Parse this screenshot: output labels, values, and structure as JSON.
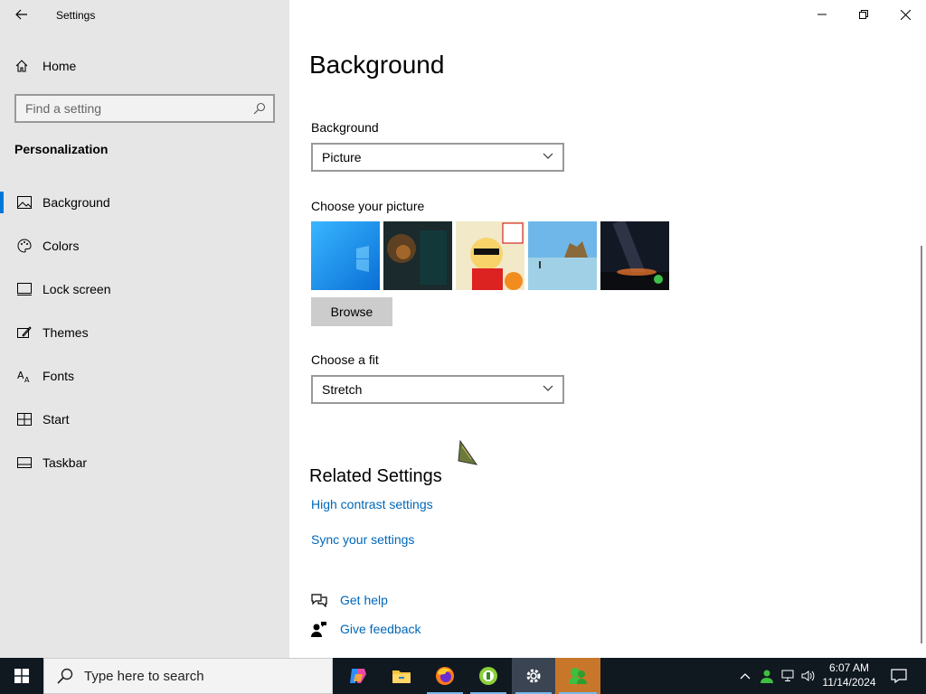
{
  "window": {
    "title": "Settings"
  },
  "sidebar": {
    "home_label": "Home",
    "search_placeholder": "Find a setting",
    "section_title": "Personalization",
    "items": [
      {
        "label": "Background",
        "icon": "picture-icon",
        "active": true
      },
      {
        "label": "Colors",
        "icon": "palette-icon"
      },
      {
        "label": "Lock screen",
        "icon": "lock-screen-icon"
      },
      {
        "label": "Themes",
        "icon": "themes-icon"
      },
      {
        "label": "Fonts",
        "icon": "fonts-icon"
      },
      {
        "label": "Start",
        "icon": "start-icon"
      },
      {
        "label": "Taskbar",
        "icon": "taskbar-icon"
      }
    ]
  },
  "main": {
    "title": "Background",
    "background_label": "Background",
    "background_value": "Picture",
    "choose_picture_label": "Choose your picture",
    "browse_label": "Browse",
    "fit_label": "Choose a fit",
    "fit_value": "Stretch",
    "related_title": "Related Settings",
    "related_links": [
      "High contrast settings",
      "Sync your settings"
    ],
    "help": {
      "get_help": "Get help",
      "give_feedback": "Give feedback"
    }
  },
  "taskbar": {
    "search_placeholder": "Type here to search",
    "time": "6:07 AM",
    "date": "11/14/2024",
    "apps": [
      "copilot-icon",
      "file-explorer-icon",
      "firefox-icon",
      "green-app-icon",
      "settings-icon",
      "game-app-icon"
    ]
  },
  "colors": {
    "accent": "#0078d7",
    "link": "#0067b8",
    "sidebar": "#e6e6e6",
    "taskbar": "#101820"
  }
}
